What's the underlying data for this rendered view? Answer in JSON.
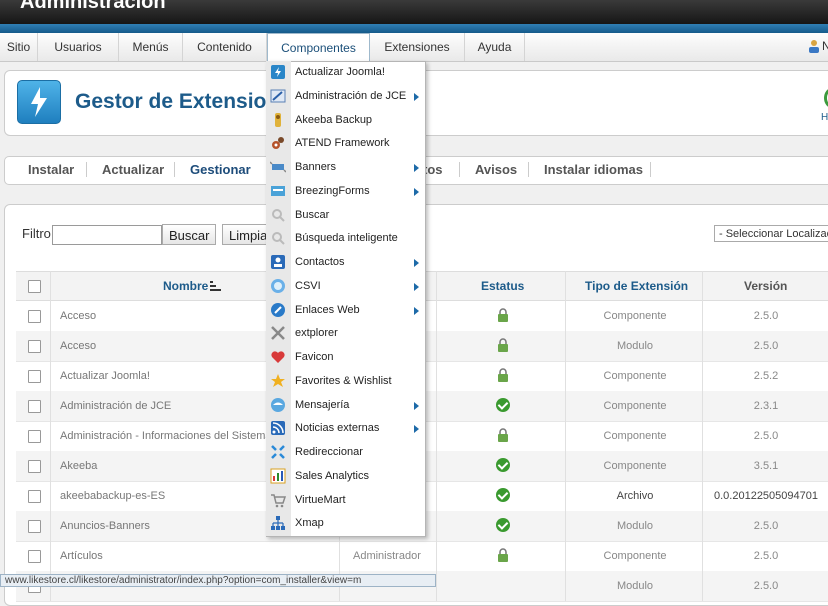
{
  "window": {
    "title": "Administración"
  },
  "menubar": {
    "items": [
      "Sitio",
      "Usuarios",
      "Menús",
      "Contenido",
      "Componentes",
      "Extensiones",
      "Ayuda"
    ],
    "user_initial": "N"
  },
  "header": {
    "title": "Gestor de Extensio",
    "help_initial": "H"
  },
  "tabs": [
    "Instalar",
    "Actualizar",
    "Gestionar",
    "tos",
    "Avisos",
    "Instalar idiomas"
  ],
  "filter": {
    "label": "Filtro:",
    "value": "",
    "search_button": "Buscar",
    "clear_button": "Limpia",
    "location_select": "- Seleccionar Localizac"
  },
  "table": {
    "headers": {
      "name": "Nombre",
      "status": "Estatus",
      "type": "Tipo de Extensión",
      "version": "Versión"
    },
    "rows": [
      {
        "name": "Acceso",
        "location": "",
        "status": "locked",
        "type": "Componente",
        "version": "2.5.0"
      },
      {
        "name": "Acceso",
        "location": "",
        "status": "locked",
        "type": "Modulo",
        "version": "2.5.0"
      },
      {
        "name": "Actualizar Joomla!",
        "location": "",
        "status": "locked",
        "type": "Componente",
        "version": "2.5.2"
      },
      {
        "name": "Administración de JCE",
        "location": "",
        "status": "enabled",
        "type": "Componente",
        "version": "2.3.1"
      },
      {
        "name": "Administración - Informaciones del Sistema",
        "location": "",
        "status": "locked",
        "type": "Componente",
        "version": "2.5.0"
      },
      {
        "name": "Akeeba",
        "location": "",
        "status": "enabled",
        "type": "Componente",
        "version": "3.5.1"
      },
      {
        "name": "akeebabackup-es-ES",
        "location": "",
        "status": "enabled",
        "type": "Archivo",
        "version": "0.0.20122505094701"
      },
      {
        "name": "Anuncios-Banners",
        "location": "",
        "status": "enabled",
        "type": "Modulo",
        "version": "2.5.0"
      },
      {
        "name": "Artículos",
        "location": "Administrador",
        "status": "locked",
        "type": "Componente",
        "version": "2.5.0"
      },
      {
        "name": "",
        "location": "",
        "status": "",
        "type": "Modulo",
        "version": "2.5.0"
      }
    ]
  },
  "dropdown": {
    "items": [
      {
        "label": "Actualizar Joomla!",
        "icon": "joomla-update-icon",
        "submenu": false
      },
      {
        "label": "Administración de JCE",
        "icon": "jce-icon",
        "submenu": true
      },
      {
        "label": "Akeeba Backup",
        "icon": "akeeba-icon",
        "submenu": false
      },
      {
        "label": "ATEND Framework",
        "icon": "gears-icon",
        "submenu": false
      },
      {
        "label": "Banners",
        "icon": "banners-icon",
        "submenu": true
      },
      {
        "label": "BreezingForms",
        "icon": "forms-icon",
        "submenu": true
      },
      {
        "label": "Buscar",
        "icon": "search-icon",
        "submenu": false
      },
      {
        "label": "Búsqueda inteligente",
        "icon": "smart-search-icon",
        "submenu": false
      },
      {
        "label": "Contactos",
        "icon": "contacts-icon",
        "submenu": true
      },
      {
        "label": "CSVI",
        "icon": "csvi-icon",
        "submenu": true
      },
      {
        "label": "Enlaces Web",
        "icon": "weblinks-icon",
        "submenu": true
      },
      {
        "label": "extplorer",
        "icon": "extplorer-icon",
        "submenu": false
      },
      {
        "label": "Favicon",
        "icon": "favicon-heart-icon",
        "submenu": false
      },
      {
        "label": "Favorites & Wishlist",
        "icon": "star-icon",
        "submenu": false
      },
      {
        "label": "Mensajería",
        "icon": "messaging-icon",
        "submenu": true
      },
      {
        "label": "Noticias externas",
        "icon": "rss-icon",
        "submenu": true
      },
      {
        "label": "Redireccionar",
        "icon": "redirect-icon",
        "submenu": false
      },
      {
        "label": "Sales Analytics",
        "icon": "analytics-icon",
        "submenu": false
      },
      {
        "label": "VirtueMart",
        "icon": "cart-icon",
        "submenu": false
      },
      {
        "label": "Xmap",
        "icon": "sitemap-icon",
        "submenu": false
      }
    ]
  },
  "statusbar": {
    "url": "www.likestore.cl/likestore/administrator/index.php?option=com_installer&view=m"
  },
  "colors": {
    "accent": "#1d5b8a",
    "ok": "#3a9a2f",
    "bluebar": "#1f6fa8"
  }
}
